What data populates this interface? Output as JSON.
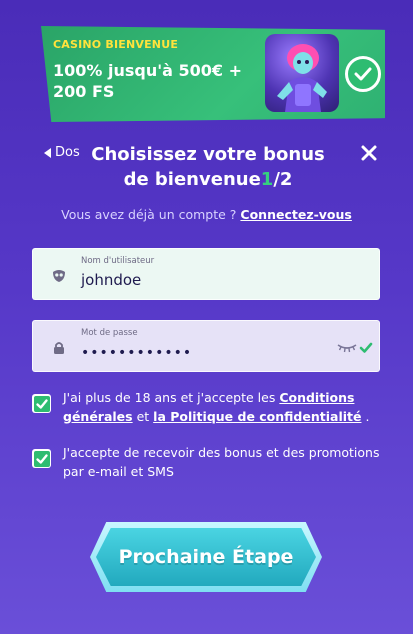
{
  "banner": {
    "kicker": "CASINO BIENVENUE",
    "offer": "100% jusqu'à 500€ + 200 FS"
  },
  "header": {
    "back_label": "Dos",
    "title_main": "Choisissez votre bonus de bienvenue",
    "step_current": "1",
    "step_total": "/2"
  },
  "login_prompt": {
    "text": "Vous avez déjà un compte ?",
    "link_label": "Connectez-vous"
  },
  "form": {
    "username": {
      "label": "Nom d'utilisateur",
      "value": "johndoe"
    },
    "password": {
      "label": "Mot de passe",
      "value": "••••••••••••"
    }
  },
  "consents": {
    "terms_part1": "J'ai plus de 18 ans et j'accepte les",
    "terms_link1": "Conditions générales",
    "terms_part2": "et",
    "terms_link2": "la Politique de confidentialité",
    "terms_part3": ".",
    "marketing": "J'accepte de recevoir des bonus et des promotions par e-mail et SMS"
  },
  "cta": {
    "label": "Prochaine Étape"
  },
  "colors": {
    "accent_green": "#36d07f",
    "cta_teal": "#22a9be",
    "background_purple": "#4a2cb8"
  }
}
